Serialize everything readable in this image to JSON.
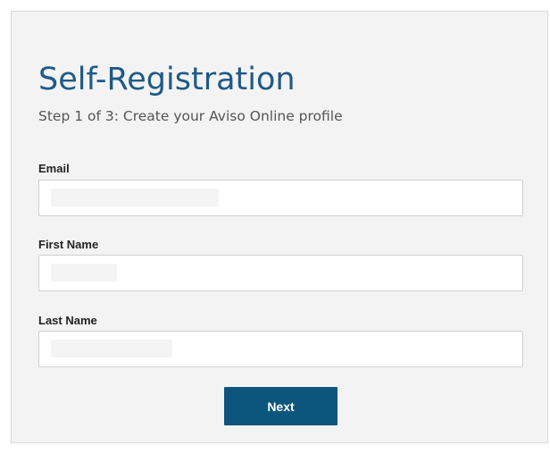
{
  "form": {
    "title": "Self-Registration",
    "subtitle": "Step 1 of 3: Create your Aviso Online profile",
    "fields": [
      {
        "label": "Email",
        "value": ""
      },
      {
        "label": "First Name",
        "value": ""
      },
      {
        "label": "Last Name",
        "value": ""
      }
    ],
    "next_label": "Next"
  },
  "colors": {
    "accent": "#0c557d",
    "title": "#1f5a87",
    "card_background": "#f3f3f3"
  }
}
